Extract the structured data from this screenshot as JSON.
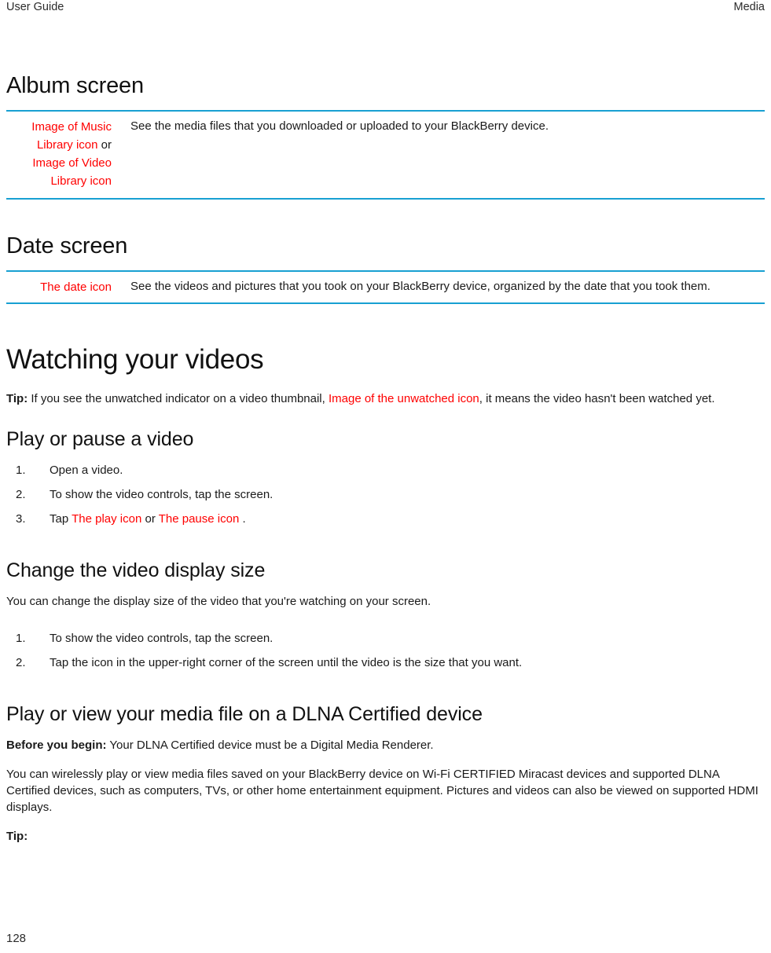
{
  "running_header": {
    "left": "User Guide",
    "right": "Media"
  },
  "colors": {
    "rule": "#18a0d2",
    "icon_placeholder_text": "#ff0000",
    "body_text": "#1a1a1a"
  },
  "sections": {
    "album_screen": {
      "heading": "Album screen",
      "row": {
        "icon_part_1": "Image of Music Library icon",
        "icon_conjunction": "or",
        "icon_part_2": "Image of Video Library icon",
        "description": "See the media files that you downloaded or uploaded to your BlackBerry device."
      }
    },
    "date_screen": {
      "heading": "Date screen",
      "row": {
        "icon": "The date icon",
        "description": "See the videos and pictures that you took on your BlackBerry device, organized by the date that you took them."
      }
    },
    "watching_your_videos": {
      "heading": "Watching your videos",
      "tip_label": "Tip:",
      "tip_text_before": "If you see the unwatched indicator on a video thumbnail,",
      "tip_icon": "Image of the unwatched icon",
      "tip_text_after": ", it means the video hasn't been watched yet."
    },
    "play_or_pause": {
      "heading": "Play or pause a video",
      "steps": [
        {
          "text": "Open a video."
        },
        {
          "text": "To show the video controls, tap the screen."
        },
        {
          "prefix": "Tap",
          "icon_1": "The play icon",
          "conjunction": "or",
          "icon_2": "The pause icon",
          "suffix": "."
        }
      ]
    },
    "change_display_size": {
      "heading": "Change the video display size",
      "intro": "You can change the display size of the video that you're watching on your screen.",
      "steps": [
        "To show the video controls, tap the screen.",
        "Tap the icon in the upper-right corner of the screen until the video is the size that you want."
      ]
    },
    "dlna": {
      "heading": "Play or view your media file on a DLNA Certified device",
      "before_label": "Before you begin:",
      "before_text": "Your DLNA Certified device must be a Digital Media Renderer.",
      "body": "You can wirelessly play or view media files saved on your BlackBerry device on Wi-Fi CERTIFIED Miracast devices and supported DLNA Certified devices, such as computers, TVs, or other home entertainment equipment. Pictures and videos can also be viewed on supported HDMI displays.",
      "tip_label": "Tip:"
    }
  },
  "page_number": "128"
}
